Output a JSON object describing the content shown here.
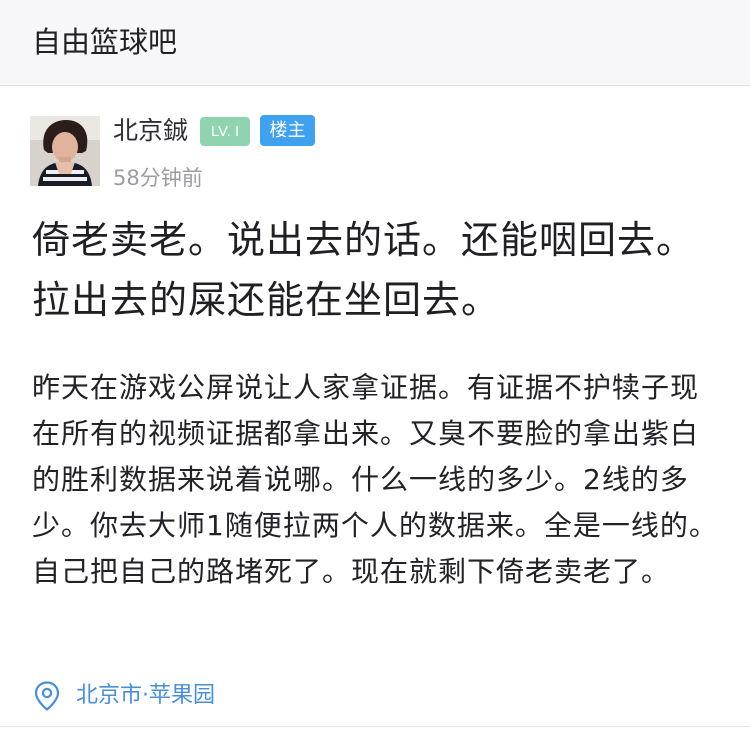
{
  "forum": {
    "title": "自由篮球吧"
  },
  "post": {
    "author": {
      "name": "北京鋮",
      "level_badge": "LV. I",
      "op_badge": "楼主"
    },
    "time": "58分钟前",
    "title": "倚老卖老。说出去的话。还能咽回去。拉出去的屎还能在坐回去。",
    "body": "昨天在游戏公屏说让人家拿证据。有证据不护犊子现在所有的视频证据都拿出来。又臭不要脸的拿出紫白的胜利数据来说着说哪。什么一线的多少。2线的多少。你去大师1随便拉两个人的数据来。全是一线的。自己把自己的路堵死了。现在就剩下倚老卖老了。",
    "location": "北京市·苹果园"
  },
  "colors": {
    "header_bg": "#f7f7f9",
    "level_badge": "#8fd3b0",
    "op_badge": "#3fa2ee",
    "location_link": "#4a8fd6",
    "secondary_text": "#9c9ca3"
  },
  "icons": {
    "avatar": "user-avatar-photo",
    "location": "location-pin-icon"
  }
}
